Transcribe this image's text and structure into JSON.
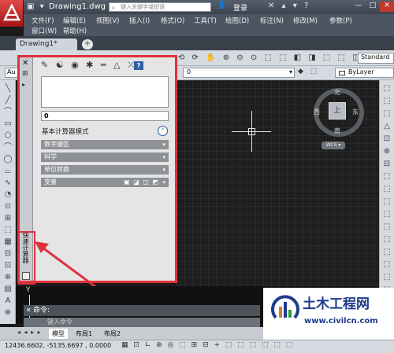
{
  "title_bar": {
    "qat_glyphs": "▣ ▾",
    "document_title": "Drawing1.dwg",
    "search_placeholder": "键入关键字或短语",
    "login_label": "登录",
    "right_glyphs": "✕ ▴ ▾ ?",
    "minimize": "—",
    "maximize": "□",
    "close": "✕"
  },
  "menu": {
    "row1": [
      "文件(F)",
      "编辑(E)",
      "视图(V)",
      "插入(I)",
      "格式(O)",
      "工具(T)",
      "绘图(D)",
      "标注(N)",
      "修改(M)",
      "参数(P)"
    ],
    "row2": [
      "窗口(W)",
      "帮助(H)"
    ]
  },
  "tabs": {
    "active": "Drawing1*",
    "add": "+"
  },
  "toolbars": {
    "row1_glyphs": "⟲ ⟳ ✋ ⊕ ⊖ ⊙ ⬚ ⬚ ◧ ◨ ⬚ ⬚ ◫ ⬚ ◩ ?",
    "style_combo": "Standard",
    "row2_glyphs": "☀ ☼ ▣",
    "left_combo": "Au",
    "layer_combo": "0",
    "bylayer_combo": "ByLayer",
    "right_glyphs": "◆ ⬚"
  },
  "left_tools": [
    "╲",
    "╱",
    "⌒",
    "▭",
    "⬠",
    "⌒",
    "◯",
    "⌓",
    "∿",
    "◔",
    "⊙",
    "⊞",
    "⬚",
    "▦",
    "⊟",
    "⊡",
    "⊕",
    "▤",
    "A",
    "⊗"
  ],
  "right_tools": [
    "⬚",
    "⬚",
    "⬚",
    "△",
    "⊡",
    "⊕",
    "⊟",
    "⬚",
    "⬚",
    "⬚",
    "⬚",
    "⬚",
    "⬚",
    "⬚",
    "⬚",
    "⬚",
    "⬚",
    "⬚",
    "⬚"
  ],
  "viewcube": {
    "north": "北",
    "south": "南",
    "east": "东",
    "west": "西",
    "top_face": "上",
    "wcs": "WCS ▾"
  },
  "calculator": {
    "close": "✕",
    "pin": "⊞",
    "props": "▸",
    "toolbar_glyphs": "✎ ☯ ◉ ✱ ═ △ ⤫",
    "help": "?",
    "input_value": "0",
    "basic_mode_label": "基本计算器模式",
    "collapse_glyph": "⌃",
    "sections": [
      {
        "label": "数字键区",
        "arrow": "▾"
      },
      {
        "label": "科学",
        "arrow": "▾"
      },
      {
        "label": "单位转换",
        "arrow": "▾"
      },
      {
        "label": "变量",
        "arrow": "▾"
      }
    ],
    "variable_icons": "▣ ◪ ◫ ◩",
    "vertical_title": "快速计算器"
  },
  "command_line": {
    "ucs_label": "Y",
    "history": "命令:",
    "close_glyph": "✕",
    "input_placeholder": "键入命令"
  },
  "layout_tabs": {
    "nav_glyphs": "◂ ◂ ▸ ▸",
    "tabs": [
      "模型",
      "布局1",
      "布局2"
    ]
  },
  "status_bar": {
    "coordinates": "12436.6602, -5135.6697 , 0.0000",
    "icons": "▦ ⊡ ∟ ⊕ ◎ ⬚ ⊞ ⊟ + ⬚ ⬚ ⬚ ⬚ ⬚ ⬚"
  },
  "watermark": {
    "title": "土木工程网",
    "url": "www.civilcn.com"
  },
  "colors": {
    "highlight": "#e0313b",
    "canvas": "#1e1e1e",
    "brand_red": "#c32020"
  }
}
